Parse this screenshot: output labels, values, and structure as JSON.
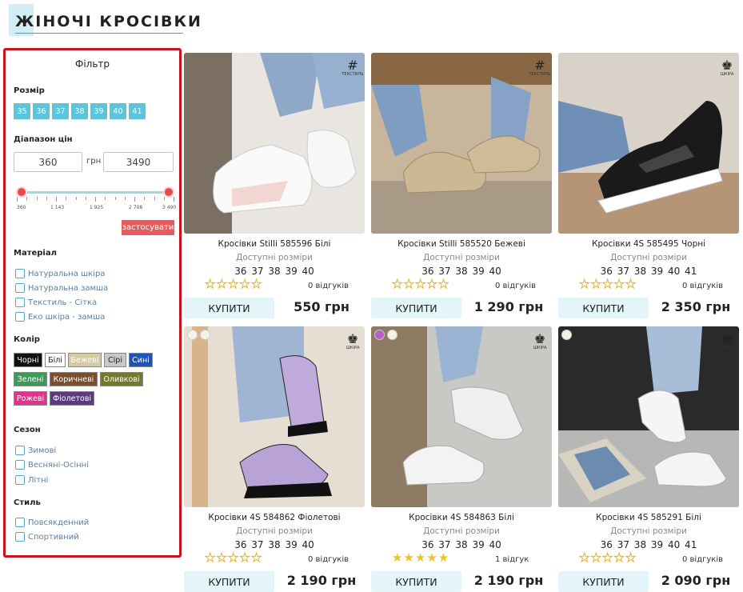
{
  "page_title": "ЖІНОЧІ КРОСІВКИ",
  "filter": {
    "title": "Фільтр",
    "size_label": "Розмір",
    "sizes": [
      "35",
      "36",
      "37",
      "38",
      "39",
      "40",
      "41"
    ],
    "price_label": "Діапазон цін",
    "price_min": "360",
    "price_max": "3490",
    "currency": "грн",
    "slider_ticks": [
      "360",
      "1 143",
      "1 925",
      "2 708",
      "3 490"
    ],
    "slider_range": [
      0.0,
      1.0
    ],
    "apply_label": "застосувати",
    "material_label": "Матеріал",
    "materials": [
      "Натуральна шкіра",
      "Натуральна замша",
      "Текстиль - Сітка",
      "Еко шкіра - замша"
    ],
    "color_label": "Колір",
    "colors": [
      {
        "label": "Чорні",
        "bg": "#111111",
        "fg": "#ffffff"
      },
      {
        "label": "Білі",
        "bg": "#ffffff",
        "fg": "#222222"
      },
      {
        "label": "Бежеві",
        "bg": "#d6caa4",
        "fg": "#ffffff"
      },
      {
        "label": "Сірі",
        "bg": "#c8c8c8",
        "fg": "#222222"
      },
      {
        "label": "Сині",
        "bg": "#1a55b7",
        "fg": "#ffffff"
      },
      {
        "label": "Зелені",
        "bg": "#3c9c57",
        "fg": "#ffffff"
      },
      {
        "label": "Коричневі",
        "bg": "#7a4e2e",
        "fg": "#ffffff"
      },
      {
        "label": "Оливкові",
        "bg": "#747a2a",
        "fg": "#ffffff"
      },
      {
        "label": "Рожеві",
        "bg": "#e0338c",
        "fg": "#ffffff"
      },
      {
        "label": "Фіолетові",
        "bg": "#5a3c7e",
        "fg": "#ffffff"
      }
    ],
    "season_label": "Сезон",
    "seasons": [
      "Зимові",
      "Весняні-Осінні",
      "Літні"
    ],
    "style_label": "Стиль",
    "styles": [
      "Повсякденний",
      "Спортивний"
    ]
  },
  "products": [
    {
      "name": "Кросівки Stilli 585596 Білі",
      "sizes_label": "Доступні розміри",
      "sizes": "36 37 38 39 40",
      "rating": 0,
      "reviews": "0 відгуків",
      "buy_label": "КУПИТИ",
      "price": "550 грн",
      "badge": "textile-icon",
      "badge_text": "ТЕКСТИЛЬ",
      "dots": []
    },
    {
      "name": "Кросівки Stilli 585520 Бежеві",
      "sizes_label": "Доступні розміри",
      "sizes": "36 37 38 39 40",
      "rating": 0,
      "reviews": "0 відгуків",
      "buy_label": "КУПИТИ",
      "price": "1 290 грн",
      "badge": "textile-icon",
      "badge_text": "ТЕКСТИЛЬ",
      "dots": []
    },
    {
      "name": "Кросівки 4S 585495 Чорні",
      "sizes_label": "Доступні розміри",
      "sizes": "36 37 38 39 40 41",
      "rating": 0,
      "reviews": "0 відгуків",
      "buy_label": "КУПИТИ",
      "price": "2 350 грн",
      "badge": "leather-icon",
      "badge_text": "ШКІРА",
      "dots": []
    },
    {
      "name": "Кросівки 4S 584862 Фіолетові",
      "sizes_label": "Доступні розміри",
      "sizes": "36 37 38 39 40",
      "rating": 0,
      "reviews": "0 відгуків",
      "buy_label": "КУПИТИ",
      "price": "2 190 грн",
      "badge": "leather-icon",
      "badge_text": "ШКІРА",
      "dots": [
        "#f4f1e6",
        "#f4f1e6"
      ]
    },
    {
      "name": "Кросівки 4S 584863 Білі",
      "sizes_label": "Доступні розміри",
      "sizes": "36 37 38 39 40",
      "rating": 5,
      "reviews": "1 відгук",
      "buy_label": "КУПИТИ",
      "price": "2 190 грн",
      "badge": "leather-icon",
      "badge_text": "ШКІРА",
      "dots": [
        "#b860c8",
        "#f4f1e6"
      ]
    },
    {
      "name": "Кросівки 4S 585291 Білі",
      "sizes_label": "Доступні розміри",
      "sizes": "36 37 38 39 40 41",
      "rating": 0,
      "reviews": "0 відгуків",
      "buy_label": "КУПИТИ",
      "price": "2 090 грн",
      "badge": "leather-icon",
      "badge_text": "ШКІРА",
      "dots": [
        "#f4f1e6"
      ]
    }
  ]
}
